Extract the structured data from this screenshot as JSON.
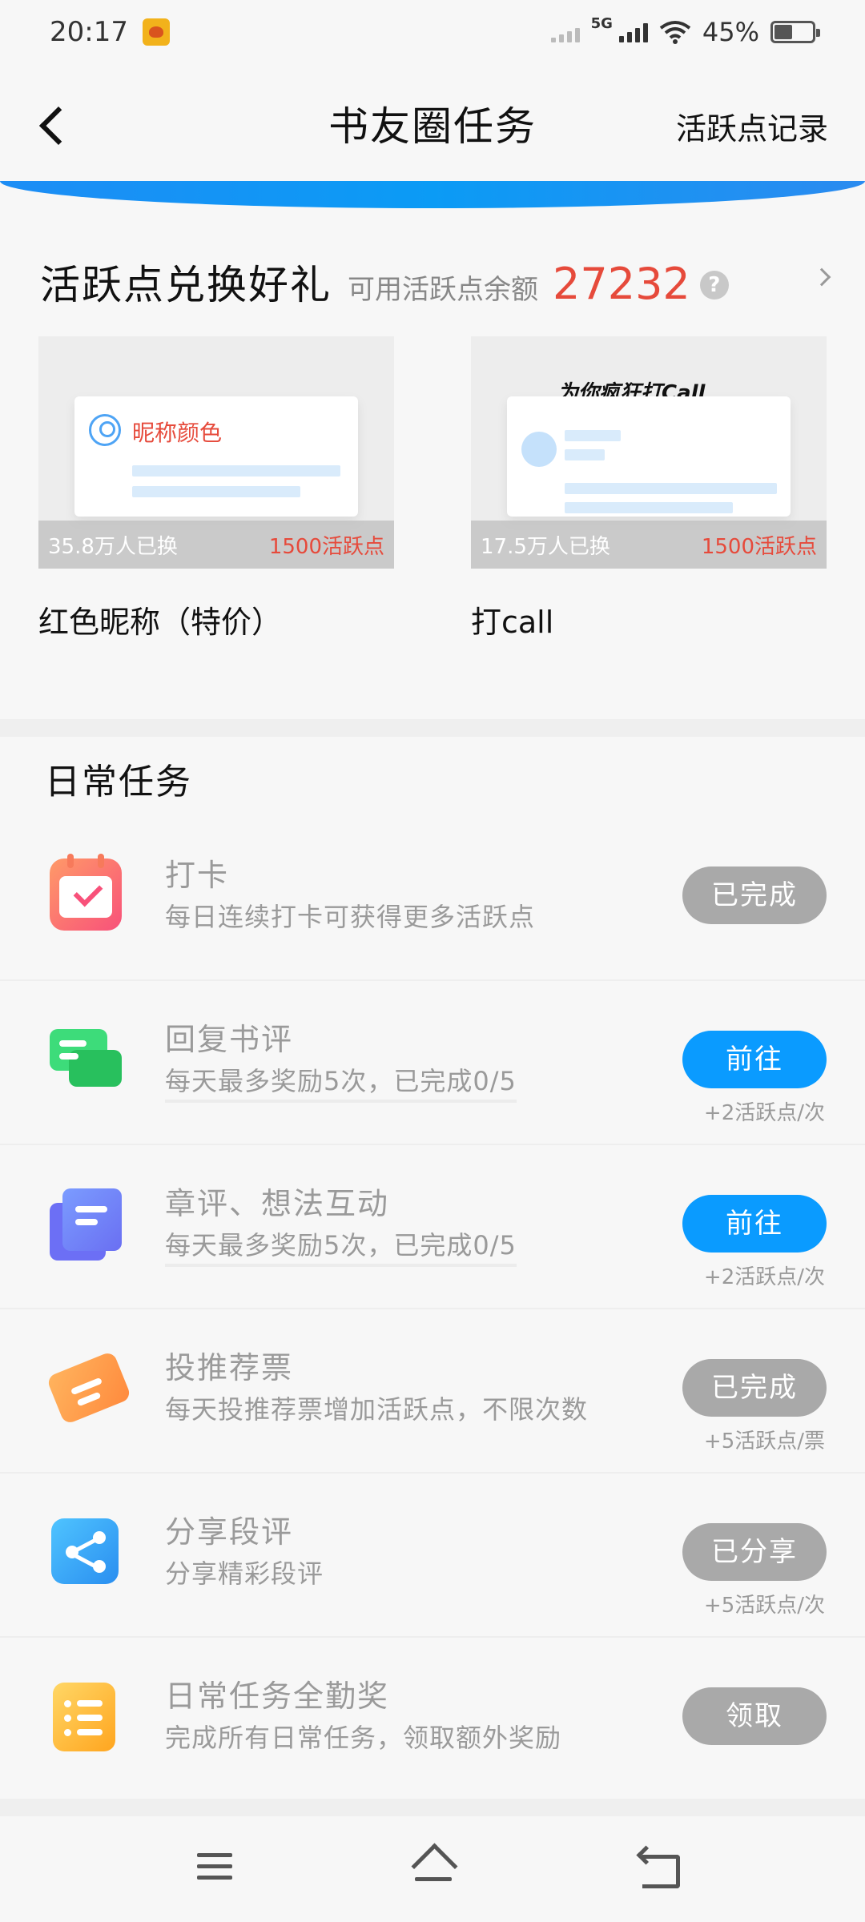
{
  "status_bar": {
    "time": "20:17",
    "network": "5G",
    "battery": "45%"
  },
  "nav": {
    "title": "书友圈任务",
    "right_link": "活跃点记录"
  },
  "exchange": {
    "title": "活跃点兑换好礼",
    "balance_label": "可用活跃点余额",
    "balance": "27232",
    "help_icon": "?",
    "gifts": [
      {
        "name": "红色昵称（特价）",
        "preview_label": "昵称颜色",
        "count": "35.8万人已换",
        "price": "1500活跃点"
      },
      {
        "name": "打call",
        "preview_label": "为你疯狂打Call",
        "count": "17.5万人已换",
        "price": "1500活跃点"
      }
    ]
  },
  "daily": {
    "title": "日常任务",
    "tasks": [
      {
        "icon": "calendar-check-icon",
        "title": "打卡",
        "desc": "每日连续打卡可获得更多活跃点",
        "button": "已完成",
        "state": "done",
        "reward": ""
      },
      {
        "icon": "chat-bubbles-icon",
        "title": "回复书评",
        "desc": "每天最多奖励5次，已完成0/5",
        "button": "前往",
        "state": "go",
        "reward": "+2活跃点/次"
      },
      {
        "icon": "document-icon",
        "title": "章评、想法互动",
        "desc": "每天最多奖励5次，已完成0/5",
        "button": "前往",
        "state": "go",
        "reward": "+2活跃点/次"
      },
      {
        "icon": "ticket-icon",
        "title": "投推荐票",
        "desc": "每天投推荐票增加活跃点，不限次数",
        "button": "已完成",
        "state": "done",
        "reward": "+5活跃点/票"
      },
      {
        "icon": "share-icon",
        "title": "分享段评",
        "desc": "分享精彩段评",
        "button": "已分享",
        "state": "done",
        "reward": "+5活跃点/次"
      },
      {
        "icon": "list-icon",
        "title": "日常任务全勤奖",
        "desc": "完成所有日常任务，领取额外奖励",
        "button": "领取",
        "state": "done",
        "reward": ""
      }
    ]
  },
  "colors": {
    "accent_blue": "#0a9bff",
    "highlight_red": "#e64a3b",
    "disabled_gray": "#a9a9a9"
  }
}
